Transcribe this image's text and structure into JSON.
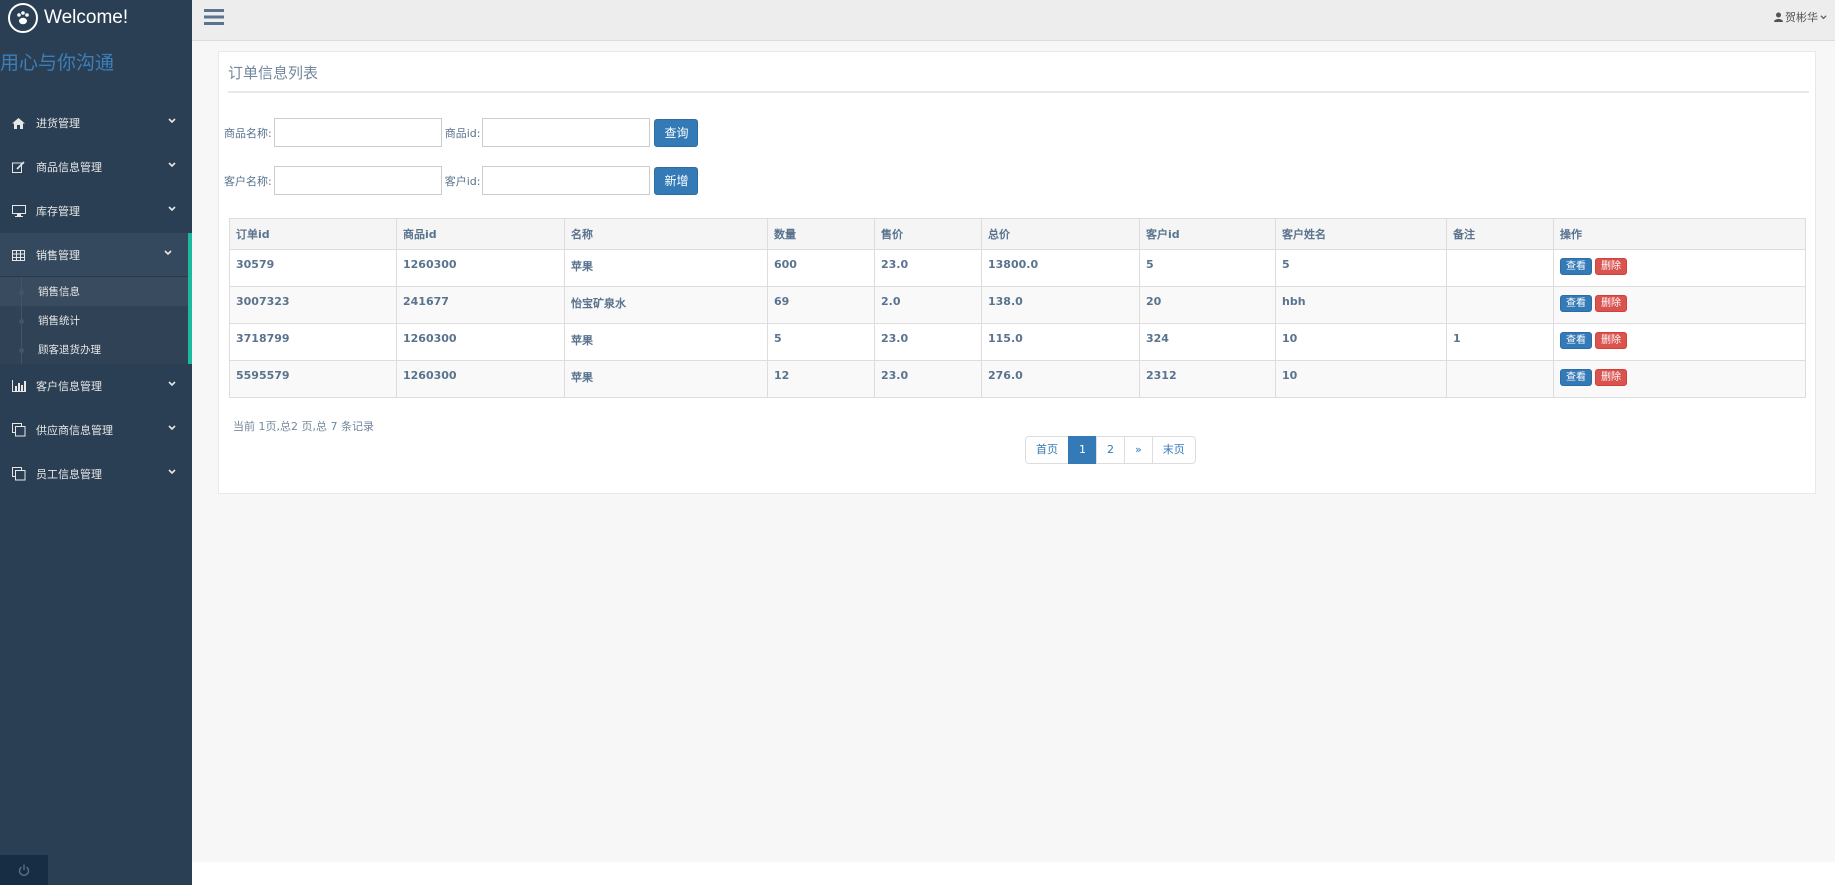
{
  "brand": {
    "title": "Welcome!",
    "slogan": "用心与你沟通"
  },
  "sidebar": {
    "items": [
      {
        "label": "进货管理",
        "icon": "home-icon"
      },
      {
        "label": "商品信息管理",
        "icon": "edit-icon"
      },
      {
        "label": "库存管理",
        "icon": "desktop-icon"
      },
      {
        "label": "销售管理",
        "icon": "table-icon"
      },
      {
        "label": "客户信息管理",
        "icon": "bar-chart-icon"
      },
      {
        "label": "供应商信息管理",
        "icon": "clone-icon"
      },
      {
        "label": "员工信息管理",
        "icon": "clone-icon"
      }
    ],
    "submenu": [
      "销售信息",
      "销售统计",
      "顾客退货办理"
    ]
  },
  "topnav": {
    "user": "贺彬华"
  },
  "panel": {
    "title": "订单信息列表"
  },
  "search": {
    "product_name_label": "商品名称:",
    "product_id_label": "商品id:",
    "query_button": "查询",
    "customer_name_label": "客户名称:",
    "customer_id_label": "客户id:",
    "add_button": "新增"
  },
  "table": {
    "headers": [
      "订单id",
      "商品id",
      "名称",
      "数量",
      "售价",
      "总价",
      "客户id",
      "客户姓名",
      "备注",
      "操作"
    ],
    "rows": [
      [
        "30579",
        "1260300",
        "苹果",
        "600",
        "23.0",
        "13800.0",
        "5",
        "5",
        ""
      ],
      [
        "3007323",
        "241677",
        "怡宝矿泉水",
        "69",
        "2.0",
        "138.0",
        "20",
        "hbh",
        ""
      ],
      [
        "3718799",
        "1260300",
        "苹果",
        "5",
        "23.0",
        "115.0",
        "324",
        "10",
        "1"
      ],
      [
        "5595579",
        "1260300",
        "苹果",
        "12",
        "23.0",
        "276.0",
        "2312",
        "10",
        ""
      ]
    ],
    "view_label": "查看",
    "delete_label": "删除"
  },
  "pagination": {
    "info": "当前 1页,总2 页,总 7 条记录",
    "first": "首页",
    "pages": [
      "1",
      "2"
    ],
    "next": "»",
    "last": "末页"
  },
  "colors": {
    "sidebar": "#2a3f54",
    "accent": "#1abb9c",
    "primary": "#337ab7",
    "danger": "#d9534f"
  }
}
